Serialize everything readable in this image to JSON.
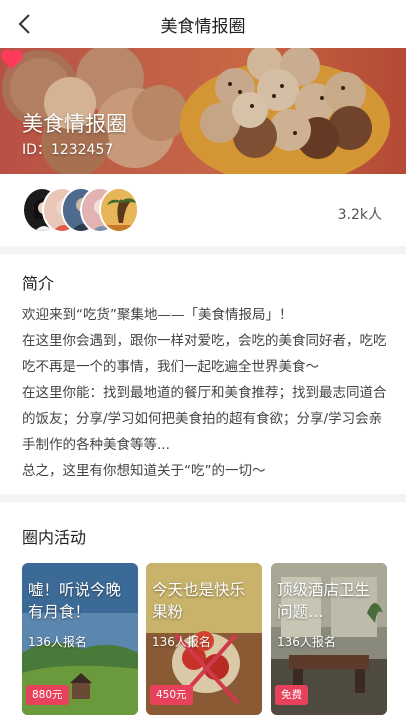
{
  "header": {
    "title": "美食情报圈",
    "back_icon": "chevron-left-icon"
  },
  "banner": {
    "title": "美食情报圈",
    "id_text": "ID：1232457",
    "like_icon": "heart-icon",
    "like_color": "#ff3b5c"
  },
  "members": {
    "count": "3.2k人",
    "avatars": 5
  },
  "intro": {
    "title": "简介",
    "lines": [
      "欢迎来到“吃货”聚集地——「美食情报局」！",
      "在这里你会遇到，跟你一样对爱吃，会吃的美食同好者，吃吃吃不再是一个的事情，我们一起吃遍全世界美食～",
      "在这里你能：找到最地道的餐厅和美食推荐；找到最志同道合的饭友；分享/学习如何把美食拍的超有食欲；分享/学习会亲手制作的各种美食等等...",
      "总之，这里有你想知道关于“吃”的一切～"
    ]
  },
  "activity": {
    "title": "圈内活动",
    "cards": [
      {
        "title": "嘘！听说今晚有月食！",
        "signups": "136人报名",
        "price": "880元"
      },
      {
        "title": "今天也是快乐果粉",
        "signups": "136人报名",
        "price": "450元"
      },
      {
        "title": "顶级酒店卫生问题…",
        "signups": "136人报名",
        "price": "免费"
      }
    ]
  },
  "colors": {
    "accent": "#e8415b",
    "banner": "#d2694f"
  }
}
